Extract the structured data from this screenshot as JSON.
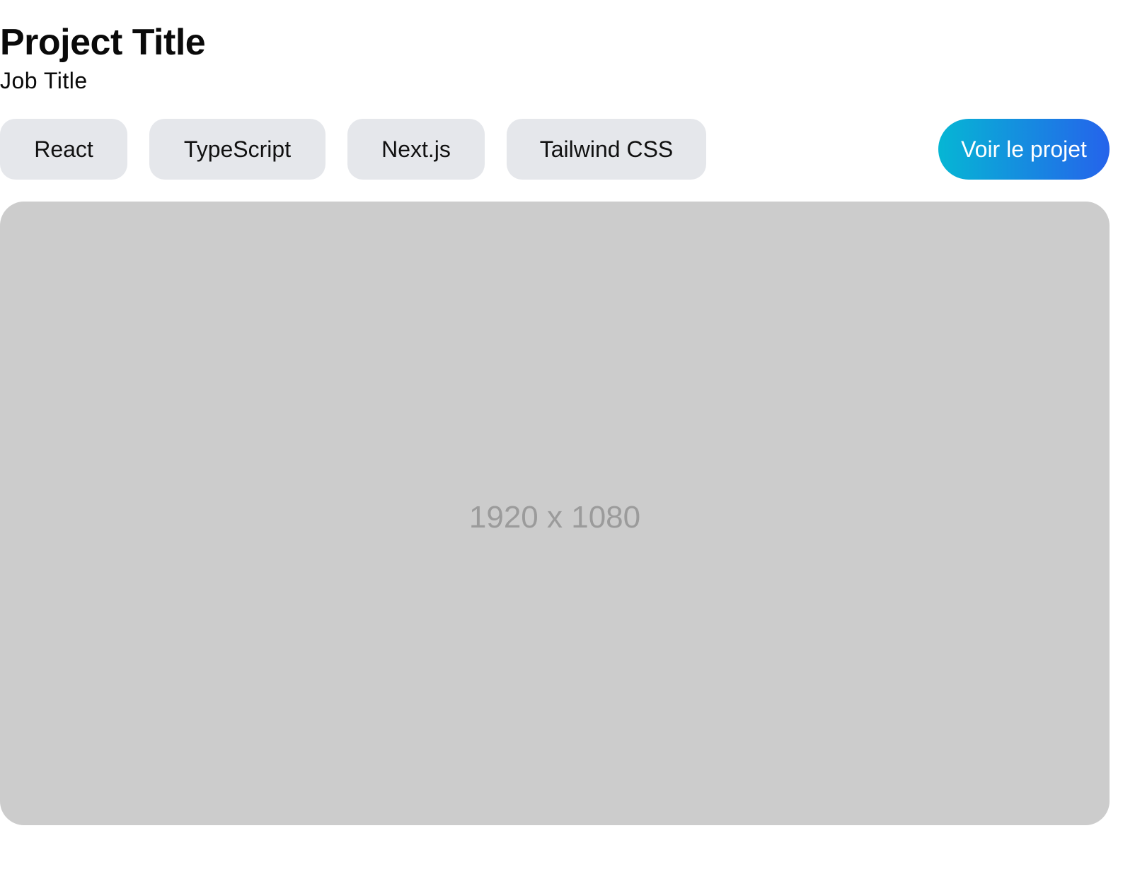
{
  "project": {
    "title": "Project Title",
    "job_title": "Job Title"
  },
  "tags": [
    {
      "label": "React"
    },
    {
      "label": "TypeScript"
    },
    {
      "label": "Next.js"
    },
    {
      "label": "Tailwind CSS"
    }
  ],
  "cta": {
    "label": "Voir le projet",
    "gradient_start": "#06b6d4",
    "gradient_end": "#2563eb"
  },
  "image": {
    "placeholder_text": "1920 x 1080",
    "background": "#cccccc"
  }
}
